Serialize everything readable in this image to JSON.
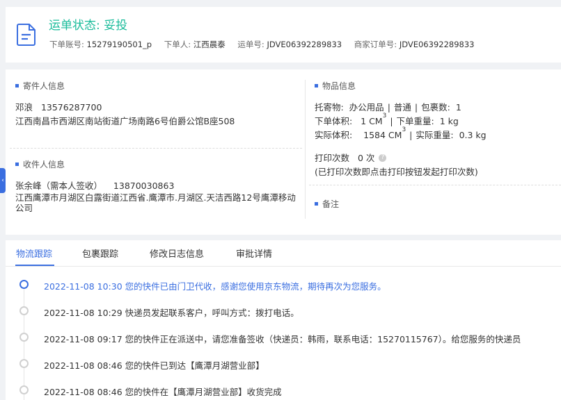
{
  "header": {
    "status_label": "运单状态: 妥投",
    "account_label": "下单账号:",
    "account_value": "15279190501_p",
    "orderer_label": "下单人:",
    "orderer_value": "江西晨泰",
    "waybill_label": "运单号:",
    "waybill_value": "JDVE06392289833",
    "merchant_order_label": "商家订单号:",
    "merchant_order_value": "JDVE06392289833",
    "icon": "document-icon"
  },
  "sender": {
    "title": "寄件人信息",
    "name": "邓浪",
    "phone": "13576287700",
    "address": "江西南昌市西湖区南站街道广场南路6号伯爵公馆B座508"
  },
  "receiver": {
    "title": "收件人信息",
    "name": "张余峰（需本人签收）",
    "phone": "13870030863",
    "address": "江西鹰潭市月湖区白露街道江西省.鹰潭市.月湖区.天洁西路12号鹰潭移动公司"
  },
  "goods": {
    "title": "物品信息",
    "consignment_label": "托寄物:",
    "consignment_value": "办公用品",
    "service_value": "普通",
    "package_label": "包裹数:",
    "package_value": "1",
    "order_volume_label": "下单体积:",
    "order_volume_value": "1 CM",
    "order_weight_label": "下单重量:",
    "order_weight_value": "1 kg",
    "actual_volume_label": "实际体积:",
    "actual_volume_value": "1584 CM",
    "actual_weight_label": "实际重量:",
    "actual_weight_value": "0.3 kg",
    "cube_superscript": "3",
    "print_label": "打印次数",
    "print_value": "0 次",
    "print_hint": "(已打印次数即点击打印按钮发起打印次数)"
  },
  "remarks": {
    "title": "备注"
  },
  "tabs": [
    {
      "label": "物流跟踪"
    },
    {
      "label": "包裹跟踪"
    },
    {
      "label": "修改日志信息"
    },
    {
      "label": "审批详情"
    }
  ],
  "timeline": [
    {
      "time": "2022-11-08 10:30",
      "text": "您的快件已由门卫代收，感谢您使用京东物流，期待再次为您服务。"
    },
    {
      "time": "2022-11-08 10:29",
      "text": "快递员发起联系客户，呼叫方式：拨打电话。"
    },
    {
      "time": "2022-11-08 09:17",
      "text": "您的快件正在派送中，请您准备签收（快递员：韩雨，联系电话：15270115767）。给您服务的快递员"
    },
    {
      "time": "2022-11-08 08:46",
      "text": "您的快件已到达【鹰潭月湖营业部】"
    },
    {
      "time": "2022-11-08 08:46",
      "text": "您的快件在【鹰潭月湖营业部】收货完成"
    }
  ],
  "colors": {
    "status": "#1bbc9b",
    "accent": "#3a6ee0"
  }
}
